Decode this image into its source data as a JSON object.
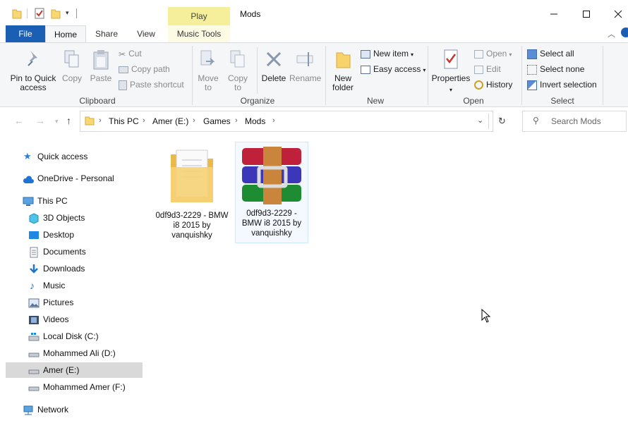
{
  "titlebar": {
    "contextual_tab": "Play",
    "title": "Mods"
  },
  "tabs": {
    "file": "File",
    "home": "Home",
    "share": "Share",
    "view": "View",
    "music_tools": "Music Tools"
  },
  "ribbon": {
    "clipboard": {
      "pin_label": "Pin to Quick access",
      "copy_label": "Copy",
      "paste_label": "Paste",
      "cut_label": "Cut",
      "copy_path_label": "Copy path",
      "paste_shortcut_label": "Paste shortcut",
      "group_label": "Clipboard"
    },
    "organize": {
      "move_to_label": "Move to",
      "copy_to_label": "Copy to",
      "delete_label": "Delete",
      "rename_label": "Rename",
      "group_label": "Organize"
    },
    "new": {
      "new_folder_label": "New folder",
      "new_item_label": "New item",
      "easy_access_label": "Easy access",
      "group_label": "New"
    },
    "open": {
      "properties_label": "Properties",
      "open_label": "Open",
      "edit_label": "Edit",
      "history_label": "History",
      "group_label": "Open"
    },
    "select": {
      "select_all_label": "Select all",
      "select_none_label": "Select none",
      "invert_selection_label": "Invert selection",
      "group_label": "Select"
    }
  },
  "address": {
    "crumbs": [
      "This PC",
      "Amer (E:)",
      "Games",
      "Mods"
    ],
    "search_placeholder": "Search Mods"
  },
  "navpane": {
    "quick_access": "Quick access",
    "onedrive": "OneDrive - Personal",
    "this_pc": "This PC",
    "objects_3d": "3D Objects",
    "desktop": "Desktop",
    "documents": "Documents",
    "downloads": "Downloads",
    "music": "Music",
    "pictures": "Pictures",
    "videos": "Videos",
    "local_disk": "Local Disk (C:)",
    "drive_d": "Mohammed Ali (D:)",
    "drive_e": "Amer (E:)",
    "drive_f": "Mohammed Amer (F:)",
    "network": "Network"
  },
  "files": [
    {
      "name": "0df9d3-2229 - BMW i8 2015 by vanquishky",
      "type": "folder",
      "icon": "folder-icon"
    },
    {
      "name": "0df9d3-2229 - BMW i8 2015 by vanquishky",
      "type": "rar-archive",
      "icon": "winrar-archive-icon",
      "selected": true
    }
  ],
  "colors": {
    "file_tab": "#1a5fb4",
    "contextual_tab": "#f5ef9c",
    "selected_nav": "#d9d9d9",
    "selected_file": "#cde8f7"
  }
}
